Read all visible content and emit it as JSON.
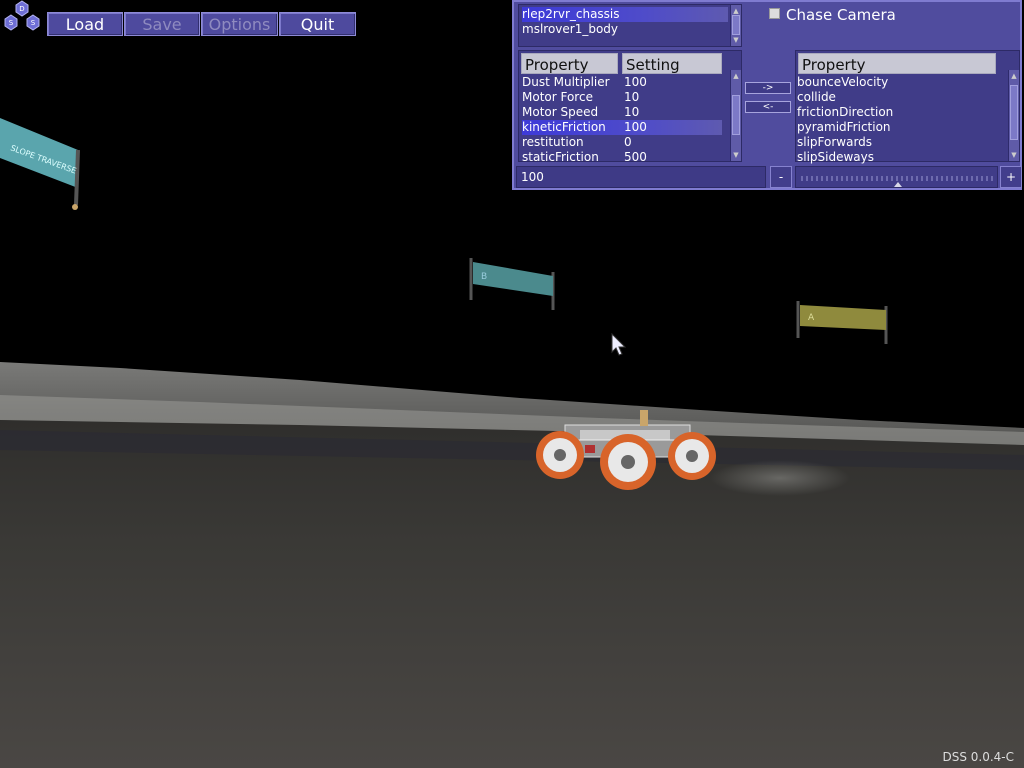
{
  "toolbar": {
    "logo_letters": [
      "D",
      "S",
      "S"
    ],
    "load_label": "Load",
    "save_label": "Save",
    "options_label": "Options",
    "quit_label": "Quit"
  },
  "bodies": {
    "items": [
      "rlep2rvr_chassis",
      "mslrover1_body"
    ],
    "selected": "rlep2rvr_chassis"
  },
  "settings_table": {
    "columns": [
      "Property",
      "Setting"
    ],
    "rows": [
      {
        "property": "Dust Multiplier",
        "setting": "100"
      },
      {
        "property": "Motor Force",
        "setting": "10"
      },
      {
        "property": "Motor Speed",
        "setting": "10"
      },
      {
        "property": "kineticFriction",
        "setting": "100"
      },
      {
        "property": "restitution",
        "setting": "0"
      },
      {
        "property": "staticFriction",
        "setting": "500"
      }
    ],
    "selected_row": "kineticFriction"
  },
  "transfer": {
    "add_label": "->",
    "remove_label": "<-"
  },
  "available_properties": {
    "column": "Property",
    "items": [
      "bounceVelocity",
      "collide",
      "frictionDirection",
      "pyramidFriction",
      "slipForwards",
      "slipSideways"
    ]
  },
  "value_field": {
    "value": "100"
  },
  "slider": {
    "minus_label": "-",
    "plus_label": "+",
    "level": 0.5
  },
  "chase_camera": {
    "label": "Chase Camera",
    "checked": false
  },
  "signs": {
    "left_sign": "SLOPE TRAVERSE",
    "middle_sign_letter": "B",
    "right_sign_letter": "A"
  },
  "version_label": "DSS 0.0.4-C",
  "colors": {
    "panel": "#504c9e",
    "selection": "#3d3ad8",
    "rover_wheels": "#d8642a",
    "sky": "#000000",
    "terrain": "#3b3a38"
  }
}
